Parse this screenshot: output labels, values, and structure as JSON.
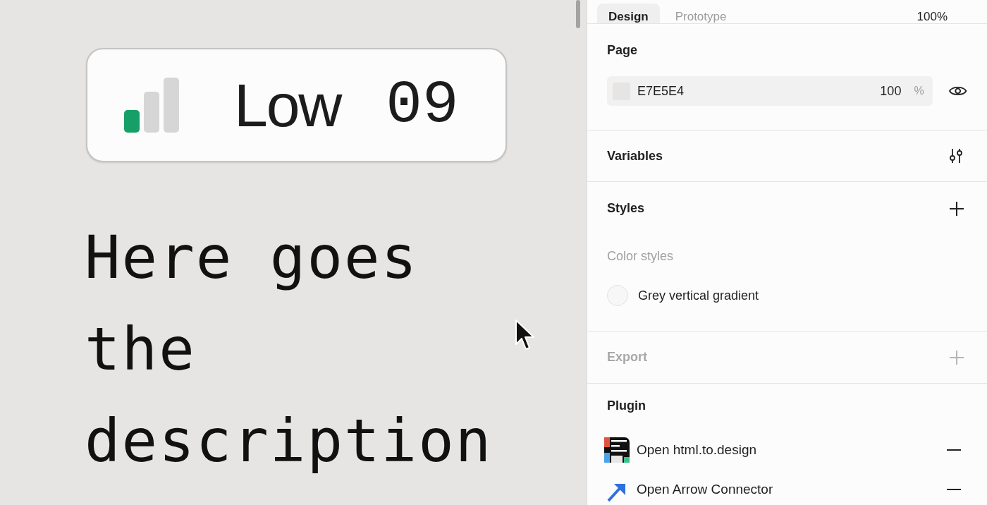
{
  "canvas": {
    "meter": {
      "label": "Low",
      "value": "09",
      "level": 0.33
    },
    "description": "Here goes the description"
  },
  "panel": {
    "tabs": [
      {
        "label": "Design",
        "selected": true
      },
      {
        "label": "Prototype",
        "selected": false
      }
    ],
    "zoom": "100%",
    "page": {
      "title": "Page",
      "hex": "E7E5E4",
      "opacity": "100",
      "unit": "%"
    },
    "variables": {
      "title": "Variables"
    },
    "styles": {
      "title": "Styles",
      "group": "Color styles",
      "items": [
        "Grey vertical gradient"
      ]
    },
    "export": {
      "title": "Export",
      "disabled": true
    },
    "plugin": {
      "title": "Plugin",
      "items": [
        {
          "kind": "html",
          "label": "Open html.to.design"
        },
        {
          "kind": "arrow",
          "label": "Open Arrow Connector"
        }
      ]
    }
  }
}
